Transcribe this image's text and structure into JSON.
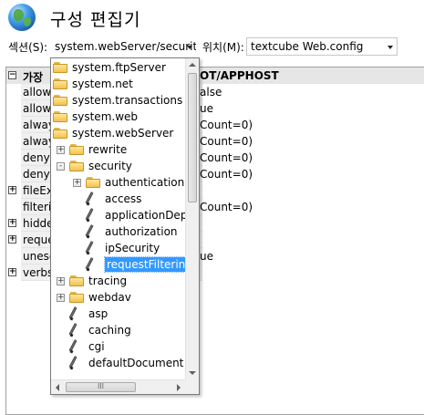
{
  "window": {
    "title": "구성 편집기"
  },
  "toolbar": {
    "section_label": "섹션(S):",
    "section_value": "system.webServer/security",
    "from_label": "위치(M):",
    "from_value": "textcube Web.config"
  },
  "grid": {
    "header_name": "가장",
    "header_value": "OT/APPHOST",
    "rows": [
      {
        "name": "allowl",
        "value": "alse",
        "expander": ""
      },
      {
        "name": "allowl",
        "value": "ue",
        "expander": ""
      },
      {
        "name": "alway",
        "value": "Count=0)",
        "expander": ""
      },
      {
        "name": "alway",
        "value": "Count=0)",
        "expander": ""
      },
      {
        "name": "deny",
        "value": "Count=0)",
        "expander": ""
      },
      {
        "name": "denyU",
        "value": "Count=0)",
        "expander": ""
      },
      {
        "name": "fileExt",
        "value": "",
        "expander": "+"
      },
      {
        "name": "filterin",
        "value": "Count=0)",
        "expander": ""
      },
      {
        "name": "hidde",
        "value": "",
        "expander": "+"
      },
      {
        "name": "reque",
        "value": "",
        "expander": "+"
      },
      {
        "name": "unesc",
        "value": "ue",
        "expander": ""
      },
      {
        "name": "verbs",
        "value": "",
        "expander": "+"
      }
    ]
  },
  "tree": {
    "items": [
      {
        "label": "system.ftpServer",
        "icon": "folder-icon",
        "expander": ""
      },
      {
        "label": "system.net",
        "icon": "folder-icon",
        "expander": ""
      },
      {
        "label": "system.transactions",
        "icon": "folder-icon",
        "expander": ""
      },
      {
        "label": "system.web",
        "icon": "folder-icon",
        "expander": ""
      },
      {
        "label": "system.webServer",
        "icon": "folder-icon",
        "expander": ""
      },
      {
        "label": "rewrite",
        "icon": "folder-icon",
        "expander": "+"
      },
      {
        "label": "security",
        "icon": "folder-icon",
        "expander": "-"
      },
      {
        "label": "authentication",
        "icon": "folder-icon",
        "expander": "+"
      },
      {
        "label": "access",
        "icon": "pen-icon",
        "expander": ""
      },
      {
        "label": "applicationDepe",
        "icon": "pen-icon",
        "expander": ""
      },
      {
        "label": "authorization",
        "icon": "pen-icon",
        "expander": ""
      },
      {
        "label": "ipSecurity",
        "icon": "pen-icon",
        "expander": ""
      },
      {
        "label": "requestFiltering",
        "icon": "pen-icon",
        "expander": "",
        "selected": true
      },
      {
        "label": "tracing",
        "icon": "folder-icon",
        "expander": "+"
      },
      {
        "label": "webdav",
        "icon": "folder-icon",
        "expander": "+"
      },
      {
        "label": "asp",
        "icon": "pen-icon",
        "expander": ""
      },
      {
        "label": "caching",
        "icon": "pen-icon",
        "expander": ""
      },
      {
        "label": "cgi",
        "icon": "pen-icon",
        "expander": ""
      },
      {
        "label": "defaultDocument",
        "icon": "pen-icon",
        "expander": ""
      }
    ],
    "hscroll_grip": "III"
  },
  "colors": {
    "selection": "#3399ff",
    "folder": "#f2c24f"
  }
}
